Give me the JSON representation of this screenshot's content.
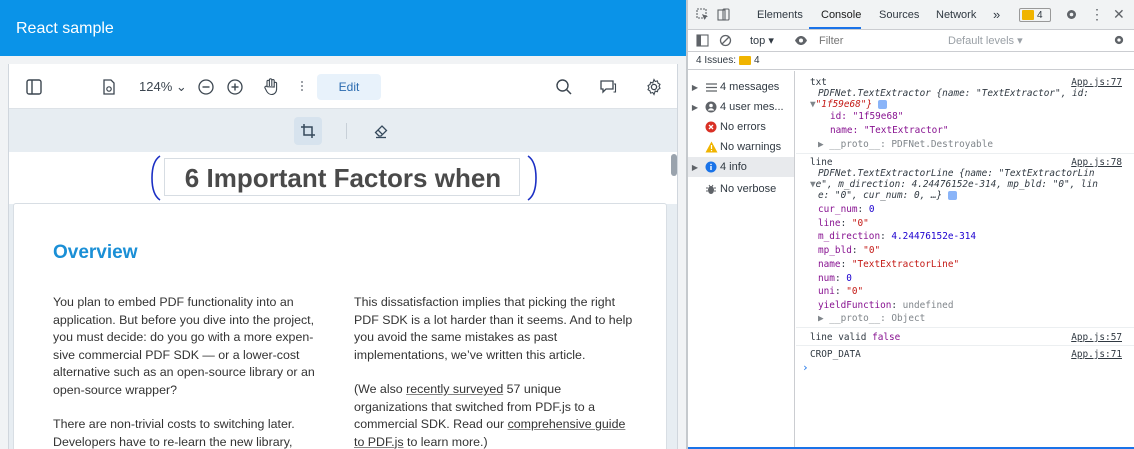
{
  "app": {
    "title": "React sample",
    "toolbar": {
      "zoom_level": "124%",
      "zoom_caret": "⌄",
      "edit_label": "Edit"
    },
    "document": {
      "headline": "6 Important Factors when",
      "section_heading": "Overview",
      "col1_p1": "You plan to embed PDF functionality into an application. But before you dive into the project, you must decide: do you go with a more expen-sive commercial PDF SDK — or a lower-cost alternative such as an open-source library or an open-source wrapper?",
      "col1_p2": "There are non-trivial costs to switching later. Developers have to re-learn the new library,",
      "col2_p1": "This dissatisfaction implies that picking the right PDF SDK is a lot harder than it seems. And to help you avoid the same mistakes as past implementations, we’ve written this article.",
      "col2_p2_a": "(We also ",
      "col2_p2_link1": "recently surveyed",
      "col2_p2_b": " 57 unique organizations that switched from PDF.js to a commercial SDK. Read our ",
      "col2_p2_link2": "comprehensive guide to PDF.js",
      "col2_p2_c": " to learn more.)"
    }
  },
  "devtools": {
    "tabs": [
      "Elements",
      "Console",
      "Sources",
      "Network"
    ],
    "more_tabs": "»",
    "active_tab": "Console",
    "issues_badge_count": "4",
    "context": "top ▾",
    "filter_placeholder": "Filter",
    "levels": "Default levels ▾",
    "issues_line": "4 Issues:",
    "issues_line_count": "4",
    "sidebar": [
      {
        "label": "4 messages",
        "icon": "list-icon"
      },
      {
        "label": "4 user mes...",
        "icon": "user-icon"
      },
      {
        "label": "No errors",
        "icon": "error-icon"
      },
      {
        "label": "No warnings",
        "icon": "warning-icon"
      },
      {
        "label": "4 info",
        "icon": "info-icon"
      },
      {
        "label": "No verbose",
        "icon": "bug-icon"
      }
    ],
    "log": {
      "txt_label": "txt",
      "txt_src": "App.js:77",
      "txt_obj1": "PDFNet.TextExtractor {name: \"TextExtractor\", id:",
      "txt_obj2": "\"1f59e68\"}",
      "txt_id": "id: \"1f59e68\"",
      "txt_name": "name: \"TextExtractor\"",
      "txt_proto": "__proto__: PDFNet.Destroyable",
      "line_label": "line",
      "line_src": "App.js:78",
      "line_obj1": "PDFNet.TextExtractorLine {name: \"TextExtractorLin",
      "line_obj2": "e\", m_direction: 4.24476152e-314, mp_bld: \"0\", lin",
      "line_obj3": "e: \"0\", cur_num: 0, …}",
      "props": [
        {
          "key": "cur_num",
          "value": "0",
          "type": "num"
        },
        {
          "key": "line",
          "value": "\"0\"",
          "type": "str"
        },
        {
          "key": "m_direction",
          "value": "4.24476152e-314",
          "type": "num"
        },
        {
          "key": "mp_bld",
          "value": "\"0\"",
          "type": "str"
        },
        {
          "key": "name",
          "value": "\"TextExtractorLine\"",
          "type": "str"
        },
        {
          "key": "num",
          "value": "0",
          "type": "num"
        },
        {
          "key": "uni",
          "value": "\"0\"",
          "type": "str"
        },
        {
          "key": "yieldFunction",
          "value": "undefined",
          "type": "undef"
        }
      ],
      "line_proto": "__proto__: Object",
      "valid_text": "line valid",
      "valid_value": "false",
      "valid_src": "App.js:57",
      "crop_text": "CROP_DATA",
      "crop_src": "App.js:71",
      "prompt": "›"
    },
    "colors": {
      "accent": "#1a73e8",
      "keyword": "#881391",
      "string": "#c41a16",
      "number": "#1c00cf",
      "warning": "#f0b400",
      "error": "#d93025"
    }
  }
}
